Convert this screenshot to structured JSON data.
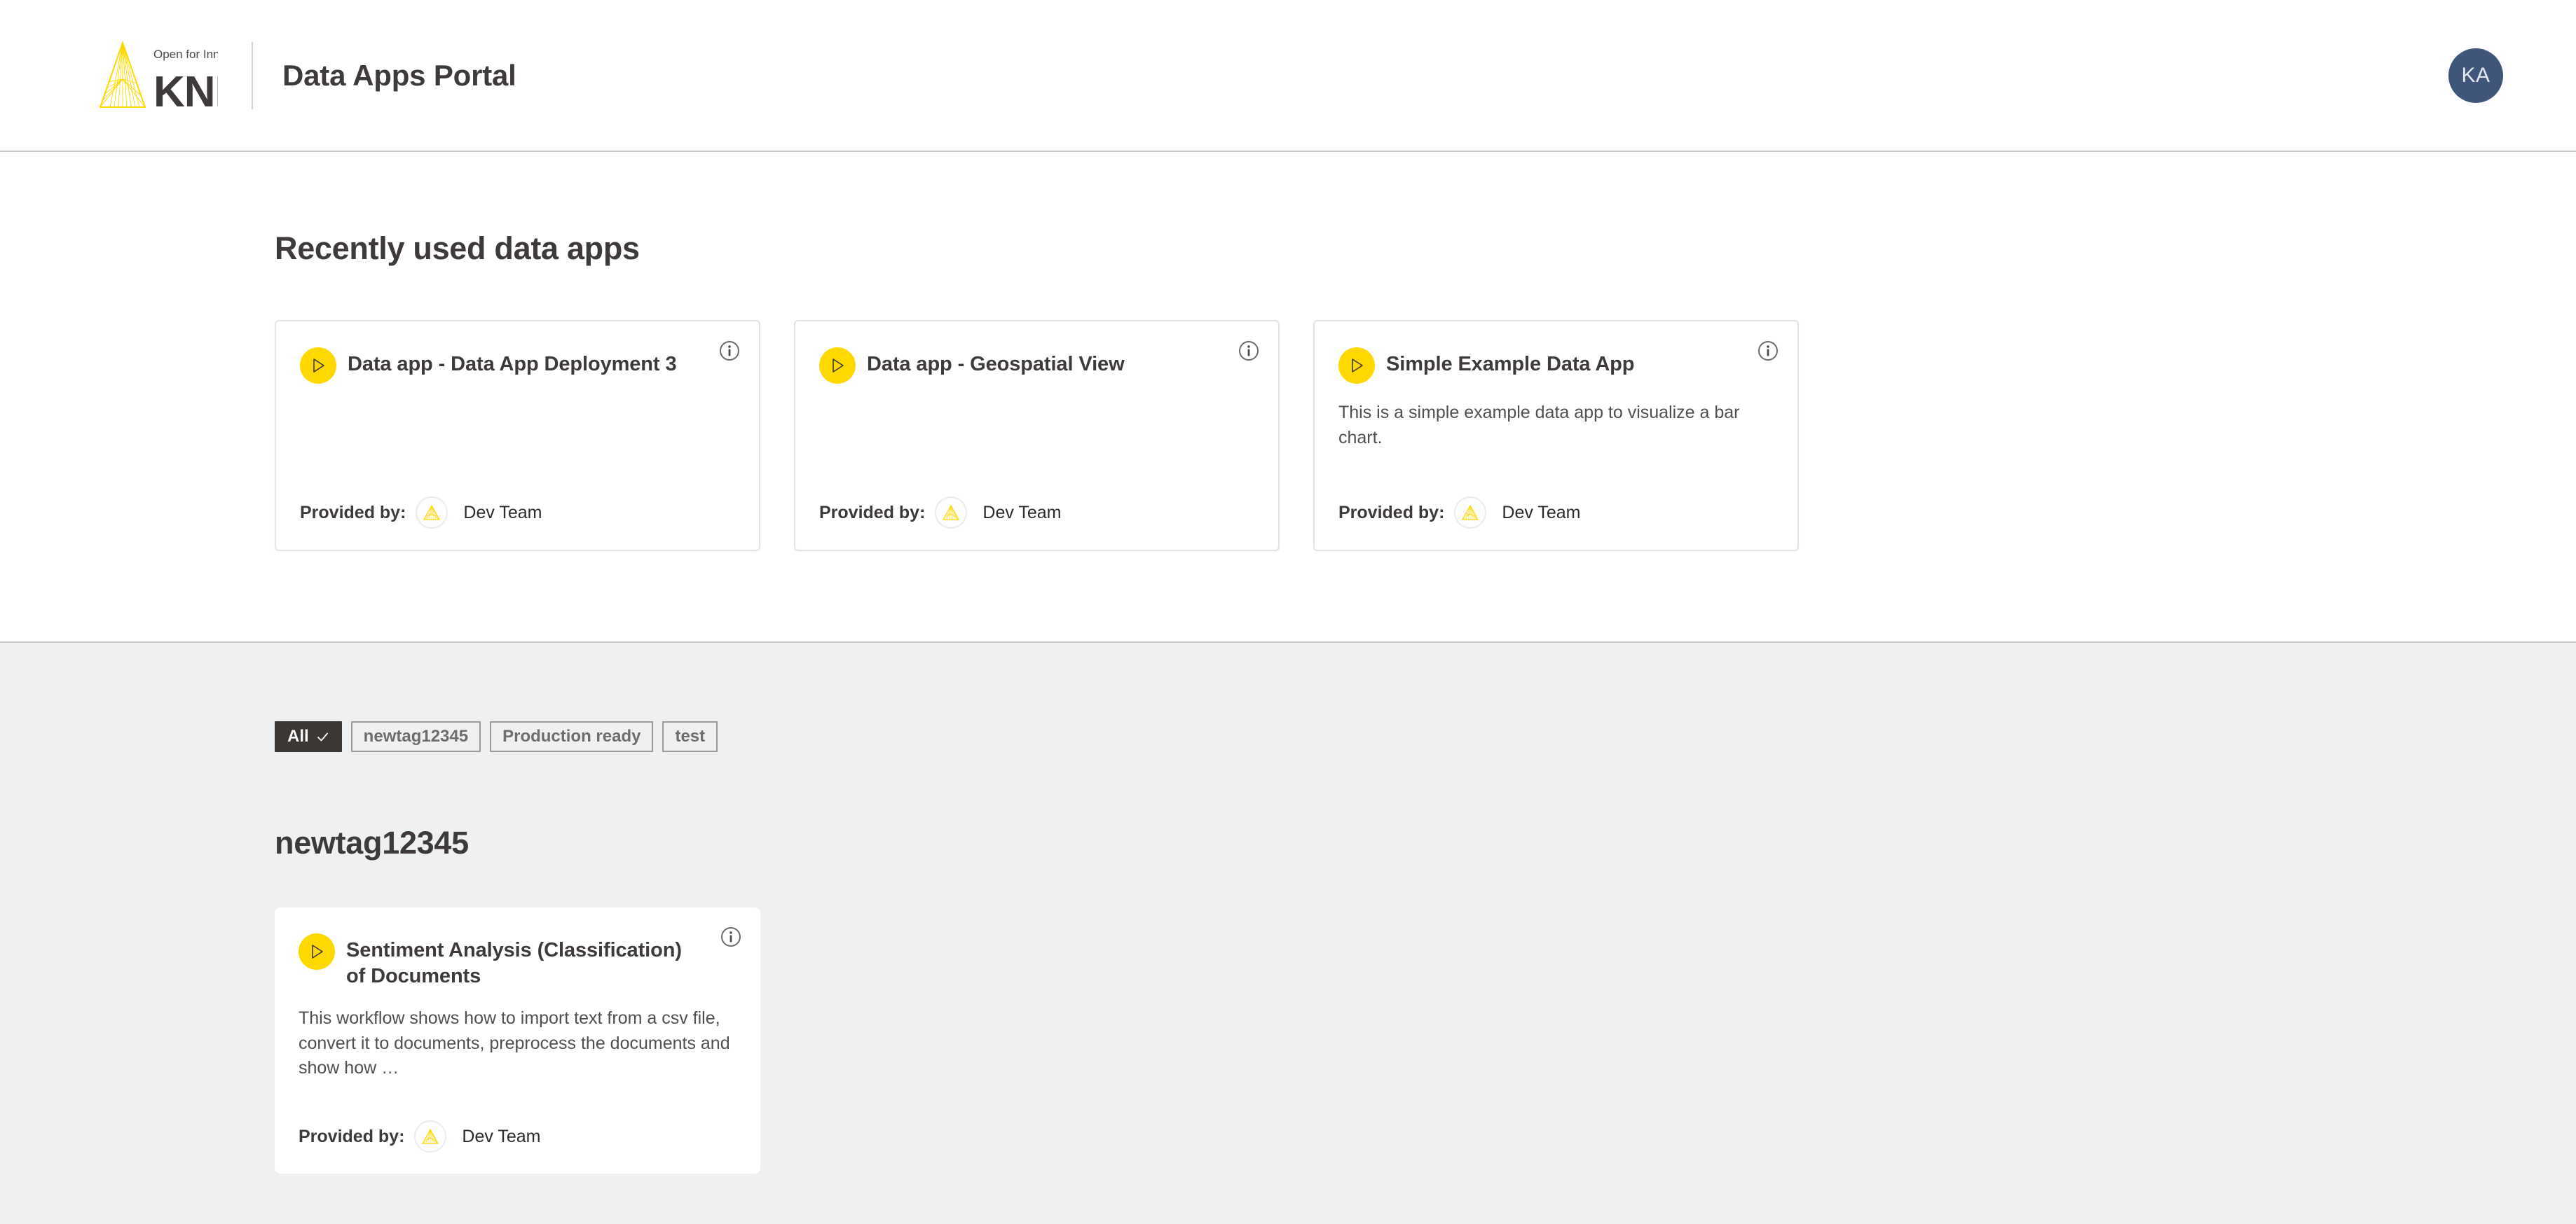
{
  "header": {
    "logo_alt": "KNIME",
    "logo_tagline": "Open for Innovation",
    "logo_wordmark": "KNIME",
    "title": "Data Apps Portal",
    "avatar_initials": "KA"
  },
  "recent_section": {
    "title": "Recently used data apps",
    "cards": [
      {
        "title": "Data app - Data App Deployment 3",
        "description": "",
        "provided_label": "Provided by:",
        "provider": "Dev Team"
      },
      {
        "title": "Data app - Geospatial View",
        "description": "",
        "provided_label": "Provided by:",
        "provider": "Dev Team"
      },
      {
        "title": "Simple Example Data App",
        "description": "This is a simple example data app to visualize a bar chart.",
        "provided_label": "Provided by:",
        "provider": "Dev Team"
      }
    ]
  },
  "tag_filter": {
    "tags": [
      {
        "label": "All",
        "selected": true
      },
      {
        "label": "newtag12345",
        "selected": false
      },
      {
        "label": "Production ready",
        "selected": false
      },
      {
        "label": "test",
        "selected": false
      }
    ]
  },
  "tag_group": {
    "title": "newtag12345",
    "cards": [
      {
        "title": "Sentiment Analysis (Classification) of Documents",
        "description": "This workflow shows how to import text from a csv file, convert it to documents, preprocess the documents and show how …",
        "provided_label": "Provided by:",
        "provider": "Dev Team"
      }
    ]
  },
  "colors": {
    "brand_yellow": "#ffd800",
    "text_dark": "#3e3a39",
    "avatar_blue": "#3f5579",
    "page_bg": "#eff0f2",
    "card_border": "#e2e4e7",
    "chip_selected_bg": "#3b3735"
  },
  "icons": {
    "info": "info-icon",
    "play": "play-icon",
    "check": "check-icon",
    "provider": "knime-triangle-icon"
  }
}
